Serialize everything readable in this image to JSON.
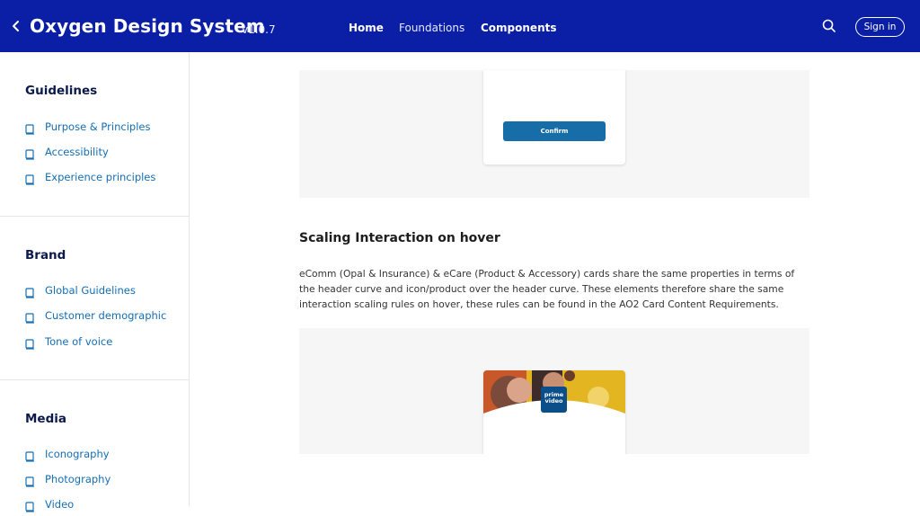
{
  "header": {
    "title": "Oxygen Design System",
    "version": "v1.0.7",
    "nav": {
      "home": "Home",
      "foundations": "Foundations",
      "components": "Components"
    },
    "sign_in": "Sign in"
  },
  "sidebar": {
    "sections": [
      {
        "heading": "Guidelines",
        "items": [
          "Purpose & Principles",
          "Accessibility",
          "Experience principles"
        ]
      },
      {
        "heading": "Brand",
        "items": [
          "Global Guidelines",
          "Customer demographic",
          "Tone of voice"
        ]
      },
      {
        "heading": "Media",
        "items": [
          "Iconography",
          "Photography",
          "Video"
        ]
      }
    ]
  },
  "main": {
    "demo_confirm_label": "Confirm",
    "section_title": "Scaling Interaction on hover",
    "body": "eComm (Opal & Insurance) & eCare (Product & Accessory) cards share the same properties in terms of the header curve and icon/product over the header curve. These elements therefore share the same interaction scaling rules on hover, these rules can be found in the AO2 Card Content Requirements.",
    "promo_logo_line1": "prime",
    "promo_logo_line2": "video"
  },
  "colors": {
    "header_bg": "#0a1fa6",
    "link": "#146eb4",
    "confirm_button": "#166da8",
    "panel_bg": "#f6f6f6"
  }
}
